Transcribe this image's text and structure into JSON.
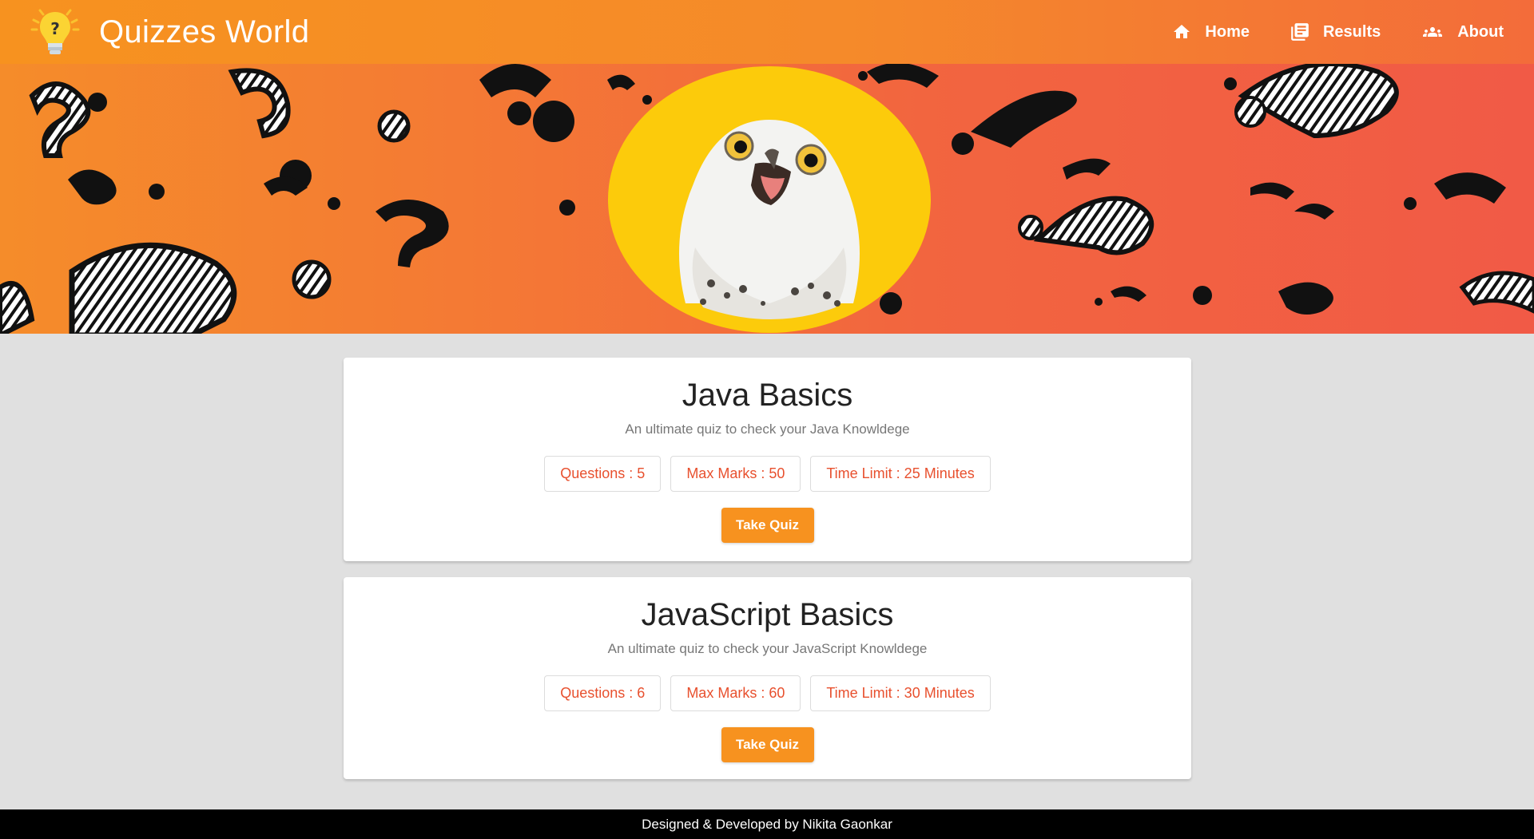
{
  "app": {
    "title": "Quizzes World",
    "logo_icon": "lightbulb-question-icon"
  },
  "nav": [
    {
      "label": "Home",
      "icon": "home-icon"
    },
    {
      "label": "Results",
      "icon": "newspaper-icon"
    },
    {
      "label": "About",
      "icon": "people-icon"
    }
  ],
  "banner": {
    "image": "owl-with-question-marks"
  },
  "quizzes": [
    {
      "title": "Java Basics",
      "description": "An ultimate quiz to check your Java Knowldege",
      "questions": "Questions : 5",
      "max_marks": "Max Marks : 50",
      "time_limit": "Time Limit : 25 Minutes",
      "button": "Take Quiz"
    },
    {
      "title": "JavaScript Basics",
      "description": "An ultimate quiz to check your JavaScript Knowldege",
      "questions": "Questions : 6",
      "max_marks": "Max Marks : 60",
      "time_limit": "Time Limit : 30 Minutes",
      "button": "Take Quiz"
    }
  ],
  "footer": {
    "text": "Designed & Developed by Nikita Gaonkar"
  },
  "colors": {
    "accent": "#f7921f",
    "chip_text": "#e8502e",
    "footer_bg": "#000000"
  }
}
